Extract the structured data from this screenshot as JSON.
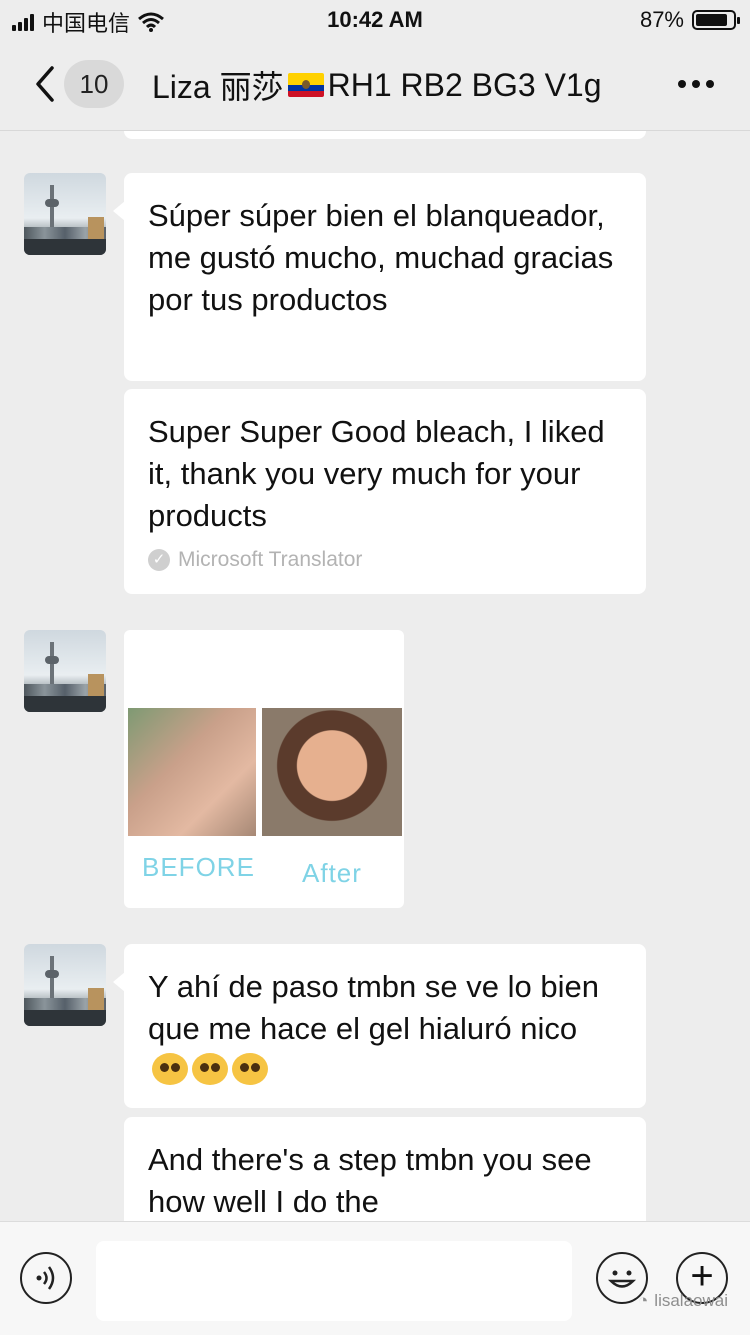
{
  "status_bar": {
    "carrier": "中国电信",
    "time": "10:42 AM",
    "battery": "87%",
    "battery_level": 0.87
  },
  "header": {
    "unread_count": "10",
    "title_name": "Liza 丽莎",
    "title_codes": "RH1 RB2 BG3 V1g"
  },
  "messages": [
    {
      "text": "Súper súper bien el blanqueador, me gustó mucho, muchad gracias por tus productos"
    },
    {
      "text": "Super Super Good bleach, I liked it, thank you very much for your products",
      "source": "Microsoft Translator"
    },
    {
      "before_label": "BEFORE",
      "after_label": "After"
    },
    {
      "text": "Y ahí de paso tmbn se ve lo bien que me hace el gel hialuró nico"
    },
    {
      "text": "And there's a step tmbn you see how well I do the"
    }
  ],
  "watermark": "lisalaowai",
  "icons": {
    "back": "chevron-left-icon",
    "more": "ellipsis-icon",
    "voice": "voice-icon",
    "emoji": "emoji-icon",
    "plus": "plus-icon"
  }
}
